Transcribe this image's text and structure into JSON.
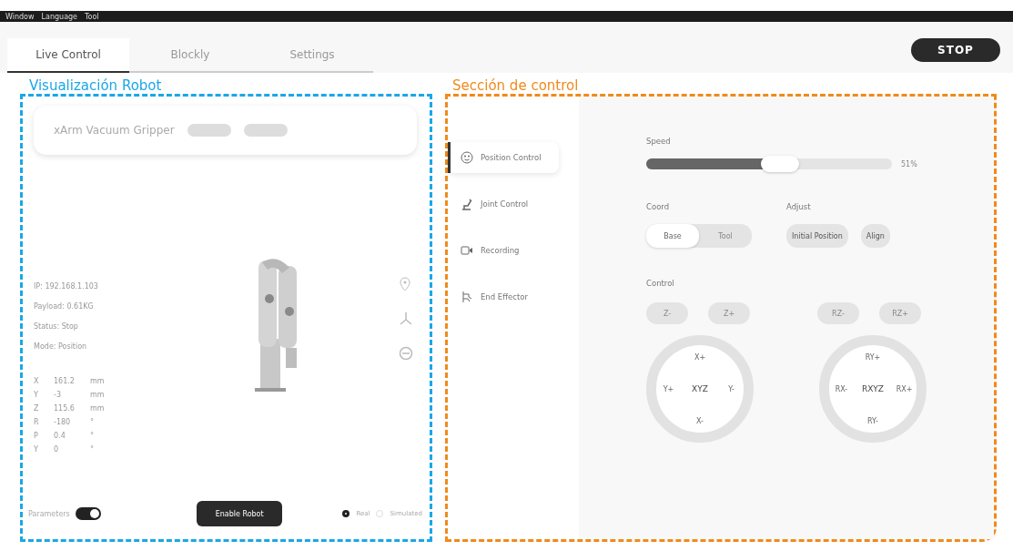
{
  "menu": [
    "Window",
    "Language",
    "Tool"
  ],
  "tabs": [
    {
      "label": "Live Control",
      "selected": true
    },
    {
      "label": "Blockly",
      "selected": false
    },
    {
      "label": "Settings",
      "selected": false
    }
  ],
  "stop_button": "STOP",
  "annotations": [
    {
      "text": "Visualización Robot",
      "color": "#1aa7e8"
    },
    {
      "text": "Sección de control",
      "color": "#f08a1c"
    }
  ],
  "robot": {
    "gripper": "xArm Vacuum Gripper",
    "info": [
      "IP: 192.168.1.103",
      "Payload: 0.61KG",
      "Status: Stop",
      "Mode: Position"
    ],
    "coords": [
      {
        "axis": "X",
        "value": "161.2",
        "unit": "mm"
      },
      {
        "axis": "Y",
        "value": "-3",
        "unit": "mm"
      },
      {
        "axis": "Z",
        "value": "115.6",
        "unit": "mm"
      },
      {
        "axis": "R",
        "value": "-180",
        "unit": "°"
      },
      {
        "axis": "P",
        "value": "0.4",
        "unit": "°"
      },
      {
        "axis": "Y",
        "value": "0",
        "unit": "°"
      }
    ],
    "parameters": {
      "label": "Parameters",
      "on": true
    },
    "enable_button": "Enable Robot",
    "modes": [
      {
        "label": "Real",
        "selected": true
      },
      {
        "label": "Simulated",
        "selected": false
      }
    ]
  },
  "control": {
    "nav": [
      {
        "label": "Position Control",
        "selected": true
      },
      {
        "label": "Joint Control",
        "selected": false
      },
      {
        "label": "Recording",
        "selected": false
      },
      {
        "label": "End Effector",
        "selected": false
      }
    ],
    "speed": {
      "label": "Speed",
      "level": 0.51,
      "reading": "51%"
    },
    "coord": {
      "label": "Coord",
      "options": [
        {
          "label": "Base",
          "selected": true
        },
        {
          "label": "Tool",
          "selected": false
        }
      ]
    },
    "adjust": {
      "label": "Adjust",
      "buttons": [
        "Initial Position",
        "Align"
      ]
    },
    "control_label": "Control",
    "step_groups": [
      [
        "Z-",
        "Z+"
      ],
      [
        "RZ-",
        "RZ+"
      ]
    ],
    "dials": [
      {
        "center": "XYZ",
        "top": "X+",
        "left": "Y+",
        "right": "Y-",
        "bottom": "X-"
      },
      {
        "center": "RXYZ",
        "top": "RY+",
        "left": "RX-",
        "right": "RX+",
        "bottom": "RY-"
      }
    ]
  }
}
